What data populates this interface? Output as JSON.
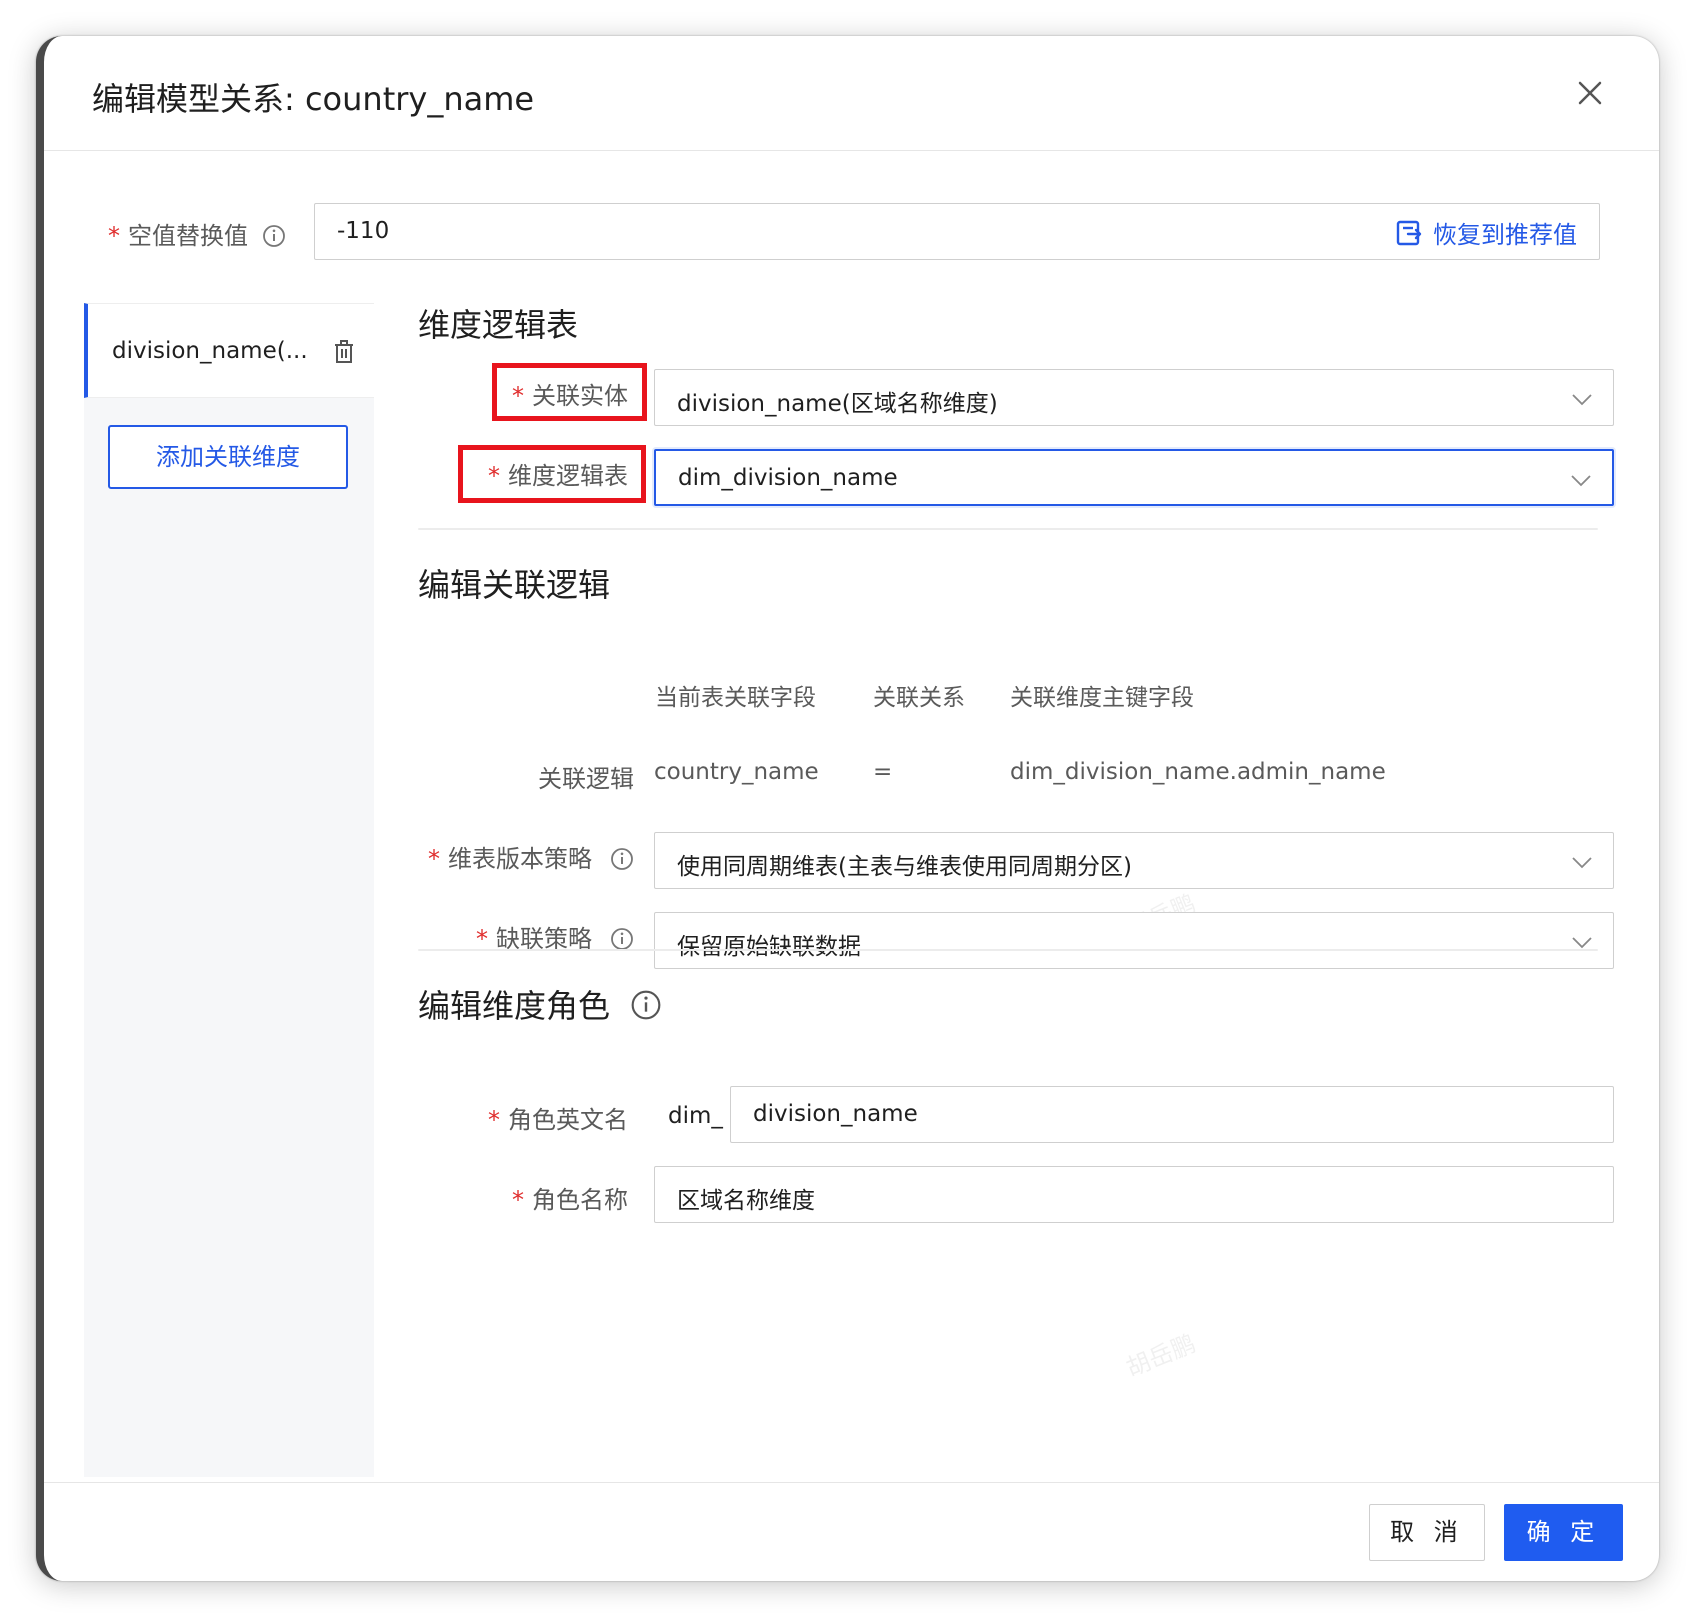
{
  "dialog": {
    "title": "编辑模型关系: country_name"
  },
  "null_replace": {
    "label": "空值替换值",
    "value": "-110",
    "restore_label": "恢复到推荐值"
  },
  "sidebar": {
    "items": [
      {
        "label": "division_name(..."
      }
    ],
    "add_button_label": "添加关联维度"
  },
  "dim_table_section": {
    "title": "维度逻辑表",
    "entity_label": "关联实体",
    "entity_value": "division_name(区域名称维度)",
    "table_label": "维度逻辑表",
    "table_value": "dim_division_name"
  },
  "logic_section": {
    "title": "编辑关联逻辑",
    "columns": [
      "当前表关联字段",
      "关联关系",
      "关联维度主键字段"
    ],
    "row_label": "关联逻辑",
    "current_field": "country_name",
    "relation": "=",
    "dim_key_field": "dim_division_name.admin_name",
    "version_label": "维表版本策略",
    "version_value": "使用同周期维表(主表与维表使用同周期分区)",
    "missing_label": "缺联策略",
    "missing_value": "保留原始缺联数据"
  },
  "role_section": {
    "title": "编辑维度角色",
    "en_name_label": "角色英文名",
    "en_name_prefix": "dim_",
    "en_name_value": "division_name",
    "name_label": "角色名称",
    "name_value": "区域名称维度"
  },
  "footer": {
    "cancel_label": "取 消",
    "ok_label": "确 定"
  },
  "watermark_text": "胡岳鹏",
  "colors": {
    "primary": "#1f5cf0",
    "required": "#e02c2c",
    "highlight_box": "#e8141d"
  }
}
